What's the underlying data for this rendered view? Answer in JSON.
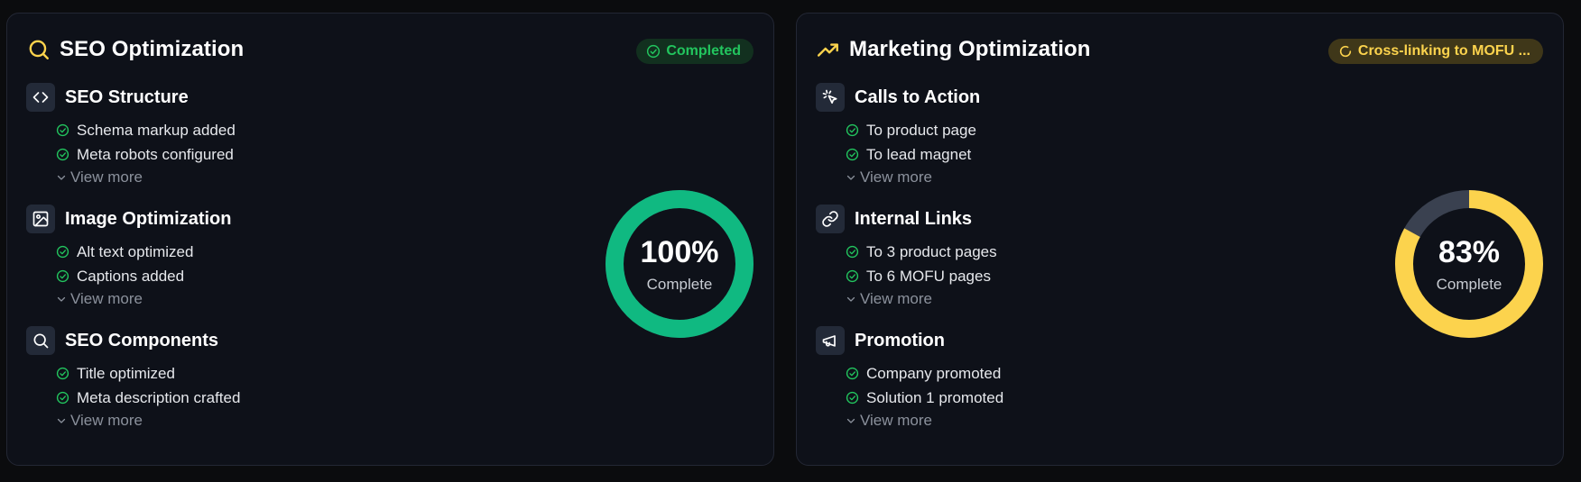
{
  "cards": [
    {
      "title": "SEO Optimization",
      "title_icon": "search-icon",
      "status": "Completed",
      "status_icon": "check-circle-icon",
      "progress_percent": 100,
      "progress_text": "100%",
      "progress_label": "Complete",
      "ring_color": "#10b981",
      "sections": [
        {
          "title": "SEO Structure",
          "icon": "code-icon",
          "items": [
            "Schema markup added",
            "Meta robots configured"
          ],
          "more": "View more"
        },
        {
          "title": "Image Optimization",
          "icon": "image-icon",
          "items": [
            "Alt text optimized",
            "Captions added"
          ],
          "more": "View more"
        },
        {
          "title": "SEO Components",
          "icon": "search-icon",
          "items": [
            "Title optimized",
            "Meta description crafted"
          ],
          "more": "View more"
        }
      ]
    },
    {
      "title": "Marketing Optimization",
      "title_icon": "trending-up-icon",
      "status": "Cross-linking to MOFU ...",
      "status_icon": "loader-icon",
      "progress_percent": 83,
      "progress_text": "83%",
      "progress_label": "Complete",
      "ring_color": "#fcd34d",
      "sections": [
        {
          "title": "Calls to Action",
          "icon": "cursor-click-icon",
          "items": [
            "To product page",
            "To lead magnet"
          ],
          "more": "View more"
        },
        {
          "title": "Internal Links",
          "icon": "link-icon",
          "items": [
            "To 3 product pages",
            "To 6 MOFU pages"
          ],
          "more": "View more"
        },
        {
          "title": "Promotion",
          "icon": "megaphone-icon",
          "items": [
            "Company promoted",
            "Solution 1 promoted"
          ],
          "more": "View more"
        }
      ]
    }
  ],
  "colors": {
    "background": "#0b0c0e",
    "card": "#0e1119",
    "check": "#22c55e",
    "ring_track": "#3a4150"
  }
}
